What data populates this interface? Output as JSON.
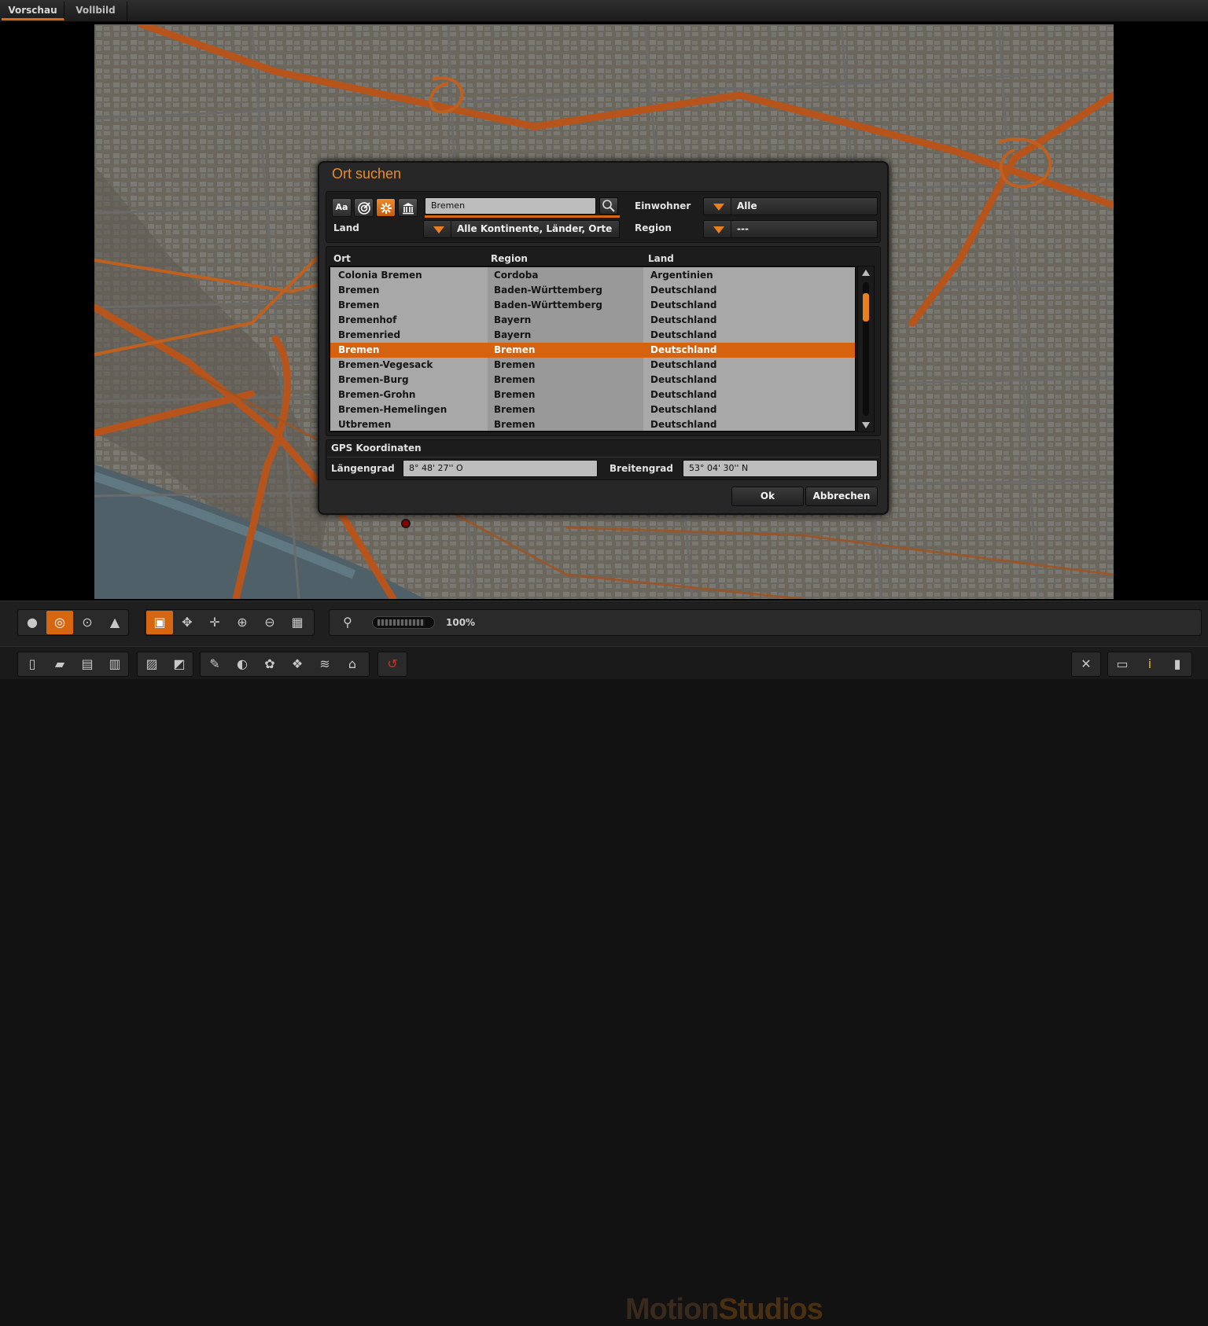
{
  "tabs": [
    {
      "label": "Vorschau",
      "active": true
    },
    {
      "label": "Vollbild",
      "active": false
    }
  ],
  "dialog": {
    "title": "Ort suchen",
    "search": {
      "value": "Bremen"
    },
    "filter_icons": [
      "Aa",
      "target-icon",
      "asterisk-icon",
      "museum-icon"
    ],
    "land_label": "Land",
    "land_value": "Alle Kontinente, Länder, Orte",
    "einwohner_label": "Einwohner",
    "einwohner_value": "Alle",
    "region_label": "Region",
    "region_value": "---",
    "columns": [
      "Ort",
      "Region",
      "Land"
    ],
    "rows": [
      {
        "ort": "Colonia Bremen",
        "region": "Cordoba",
        "land": "Argentinien",
        "selected": false
      },
      {
        "ort": "Bremen",
        "region": "Baden-Württemberg",
        "land": "Deutschland",
        "selected": false
      },
      {
        "ort": "Bremen",
        "region": "Baden-Württemberg",
        "land": "Deutschland",
        "selected": false
      },
      {
        "ort": "Bremenhof",
        "region": "Bayern",
        "land": "Deutschland",
        "selected": false
      },
      {
        "ort": "Bremenried",
        "region": "Bayern",
        "land": "Deutschland",
        "selected": false
      },
      {
        "ort": "Bremen",
        "region": "Bremen",
        "land": "Deutschland",
        "selected": true
      },
      {
        "ort": "Bremen-Vegesack",
        "region": "Bremen",
        "land": "Deutschland",
        "selected": false
      },
      {
        "ort": "Bremen-Burg",
        "region": "Bremen",
        "land": "Deutschland",
        "selected": false
      },
      {
        "ort": "Bremen-Grohn",
        "region": "Bremen",
        "land": "Deutschland",
        "selected": false
      },
      {
        "ort": "Bremen-Hemelingen",
        "region": "Bremen",
        "land": "Deutschland",
        "selected": false
      },
      {
        "ort": "Utbremen",
        "region": "Bremen",
        "land": "Deutschland",
        "selected": false
      }
    ],
    "gps_title": "GPS Koordinaten",
    "laengengrad_label": "Längengrad",
    "laengengrad_value": "8° 48' 27'' O",
    "breitengrad_label": "Breitengrad",
    "breitengrad_value": "53° 04' 30'' N",
    "ok_label": "Ok",
    "cancel_label": "Abbrechen"
  },
  "toolbar": {
    "zoom": "100%"
  },
  "logo": {
    "part1": "Motion",
    "part2": "Studios"
  },
  "colors": {
    "accent": "#d6660f",
    "title": "#e98c2e",
    "selection": "#d5620e"
  }
}
